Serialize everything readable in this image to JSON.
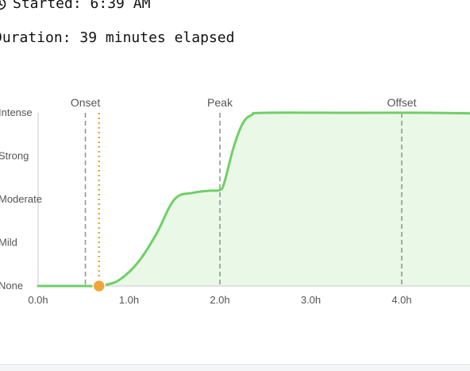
{
  "status": {
    "started_label": "Started:",
    "started_time": "6:39 AM",
    "duration_label": "Duration:",
    "duration_text": "39 minutes elapsed",
    "clock_icon": "clock-icon"
  },
  "chart_data": {
    "type": "area",
    "xlabel": "",
    "ylabel": "",
    "x_ticks": [
      "0.0h",
      "1.0h",
      "2.0h",
      "3.0h",
      "4.0h"
    ],
    "y_levels": [
      "None",
      "Mild",
      "Moderate",
      "Strong",
      "Intense"
    ],
    "xlim": [
      0,
      4.95
    ],
    "ylim": [
      0,
      4
    ],
    "series": [
      {
        "color": "#6fcf67",
        "fill": "#eaf8e7",
        "points": [
          [
            0,
            0
          ],
          [
            0.52,
            0
          ],
          [
            0.65,
            0
          ],
          [
            0.75,
            0.03
          ],
          [
            0.9,
            0.15
          ],
          [
            1.1,
            0.55
          ],
          [
            1.3,
            1.2
          ],
          [
            1.5,
            2.0
          ],
          [
            1.7,
            2.15
          ],
          [
            1.88,
            2.2
          ],
          [
            2.0,
            2.22
          ],
          [
            2.05,
            2.4
          ],
          [
            2.15,
            3.2
          ],
          [
            2.25,
            3.75
          ],
          [
            2.35,
            3.95
          ],
          [
            2.5,
            4.0
          ],
          [
            3.5,
            4.0
          ],
          [
            4.3,
            4.0
          ],
          [
            4.95,
            3.98
          ]
        ]
      }
    ],
    "markers": [
      {
        "label": "Onset",
        "x": 0.52,
        "color": "#8e8e93"
      },
      {
        "label": "Peak",
        "x": 2.0,
        "color": "#8e8e93"
      },
      {
        "label": "Offset",
        "x": 4.0,
        "color": "#8e8e93"
      }
    ],
    "now": {
      "x": 0.67,
      "y": 0,
      "color": "#f0a43a"
    },
    "colors": {
      "axis": "#c8c8cc",
      "tick_text": "#555555",
      "marker_text": "#555555"
    }
  }
}
